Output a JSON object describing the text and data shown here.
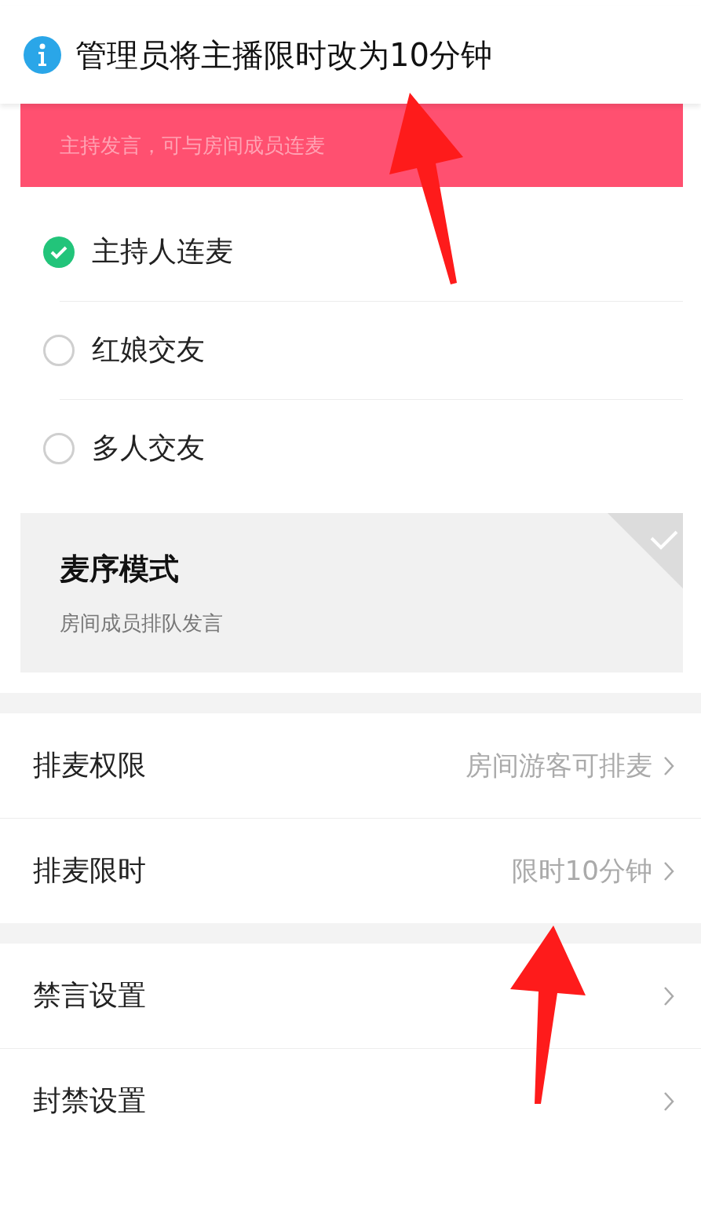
{
  "toast": {
    "text": "管理员将主播限时改为10分钟"
  },
  "mode_cards": [
    {
      "subtitle": "主持发言，可与房间成员连麦",
      "selected": true,
      "options": [
        {
          "label": "主持人连麦",
          "selected": true
        },
        {
          "label": "红娘交友",
          "selected": false
        },
        {
          "label": "多人交友",
          "selected": false
        }
      ]
    },
    {
      "title": "麦序模式",
      "subtitle": "房间成员排队发言",
      "selected": false
    }
  ],
  "setting_groups": [
    [
      {
        "label": "排麦权限",
        "value": "房间游客可排麦"
      },
      {
        "label": "排麦限时",
        "value": "限时10分钟"
      }
    ],
    [
      {
        "label": "禁言设置"
      },
      {
        "label": "封禁设置"
      }
    ]
  ]
}
